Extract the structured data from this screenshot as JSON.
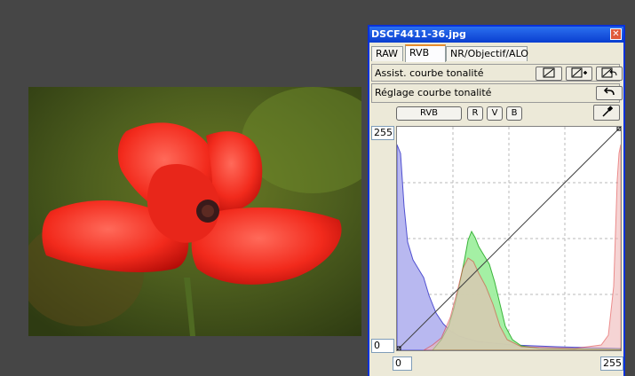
{
  "window": {
    "title": "DSCF4411-36.jpg",
    "close_label": "✕"
  },
  "tabs": [
    {
      "label": "RAW"
    },
    {
      "label": "RVB"
    },
    {
      "label": "NR/Objectif/ALO"
    }
  ],
  "panels": {
    "assist_label": "Assist. courbe tonalité",
    "reglage_label": "Réglage courbe tonalité"
  },
  "channels": {
    "all": "RVB",
    "r": "R",
    "v": "V",
    "b": "B"
  },
  "curve": {
    "y_max_label": "255",
    "y_min_label": "0",
    "input_low": "0",
    "input_high": "255"
  },
  "colors": {
    "titlebar": "#0a3ed0",
    "accent_tab": "#e68b2c"
  }
}
